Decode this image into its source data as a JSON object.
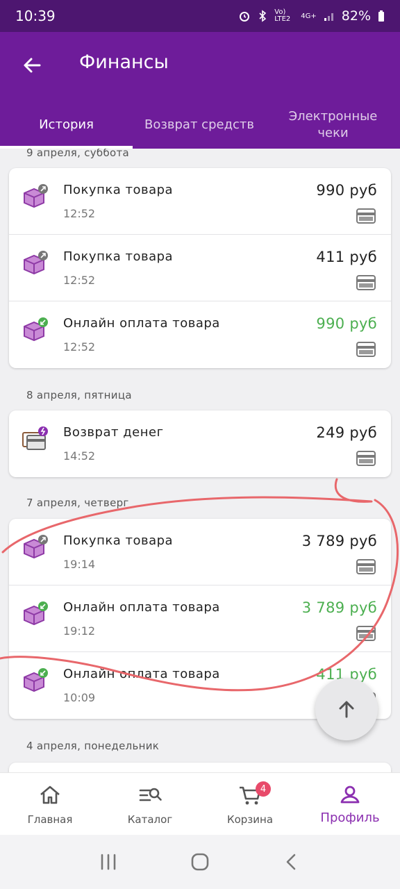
{
  "status_bar": {
    "time": "10:39",
    "network": "Vo) LTE2",
    "network_type": "4G+",
    "battery": "82%"
  },
  "app_bar": {
    "title": "Финансы",
    "tabs": [
      {
        "label": "История",
        "active": true
      },
      {
        "label": "Возврат средств",
        "active": false
      },
      {
        "label": "Электронные чеки",
        "active": false
      }
    ]
  },
  "groups": [
    {
      "date": "9 апреля, суббота",
      "transactions": [
        {
          "title": "Покупка товара",
          "time": "12:52",
          "amount": "990 руб",
          "type": "purchase"
        },
        {
          "title": "Покупка товара",
          "time": "12:52",
          "amount": "411 руб",
          "type": "purchase"
        },
        {
          "title": "Онлайн оплата товара",
          "time": "12:52",
          "amount": "990 руб",
          "type": "payment"
        }
      ]
    },
    {
      "date": "8 апреля, пятница",
      "transactions": [
        {
          "title": "Возврат денег",
          "time": "14:52",
          "amount": "249 руб",
          "type": "refund"
        }
      ]
    },
    {
      "date": "7 апреля, четверг",
      "transactions": [
        {
          "title": "Покупка товара",
          "time": "19:14",
          "amount": "3 789 руб",
          "type": "purchase"
        },
        {
          "title": "Онлайн оплата товара",
          "time": "19:12",
          "amount": "3 789 руб",
          "type": "payment"
        },
        {
          "title": "Онлайн оплата товара",
          "time": "10:09",
          "amount": "411 руб",
          "type": "payment"
        }
      ]
    },
    {
      "date": "4 апреля, понедельник",
      "transactions": []
    }
  ],
  "bottom_nav": {
    "items": [
      {
        "label": "Главная",
        "icon": "home-icon"
      },
      {
        "label": "Каталог",
        "icon": "catalog-search-icon"
      },
      {
        "label": "Корзина",
        "icon": "cart-icon",
        "badge": "4"
      },
      {
        "label": "Профиль",
        "icon": "profile-icon",
        "active": true
      }
    ]
  },
  "colors": {
    "primary": "#6e1c9a",
    "status_bar": "#4d1670",
    "accent": "#8b2fb0",
    "green_amount": "#4caf50",
    "badge": "#e84a6a",
    "annotation": "#e8676b"
  }
}
